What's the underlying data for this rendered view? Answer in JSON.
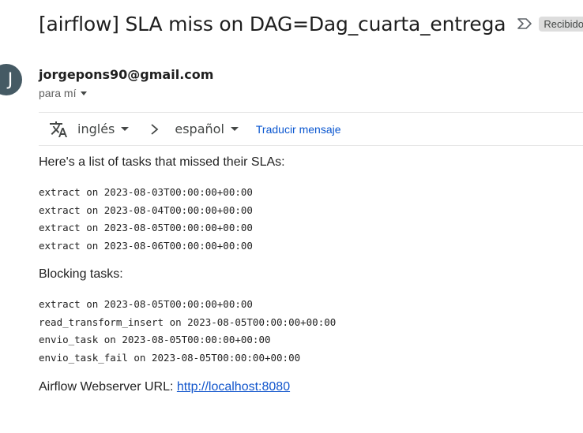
{
  "email": {
    "subject": "[airflow] SLA miss on DAG=Dag_cuarta_entrega",
    "label_chip": "Recibidos",
    "sender": "jorgepons90@gmail.com",
    "recipient": "para mí",
    "avatar_letter": "J"
  },
  "translate_bar": {
    "source_lang": "inglés",
    "target_lang": "español",
    "translate_link": "Traducir mensaje"
  },
  "body": {
    "intro": "Here's a list of tasks that missed their SLAs:",
    "missed_tasks": [
      "extract on 2023-08-03T00:00:00+00:00",
      "extract on 2023-08-04T00:00:00+00:00",
      "extract on 2023-08-05T00:00:00+00:00",
      "extract on 2023-08-06T00:00:00+00:00"
    ],
    "blocking_heading": "Blocking tasks:",
    "blocking_tasks": [
      "extract on 2023-08-05T00:00:00+00:00",
      "read_transform_insert on 2023-08-05T00:00:00+00:00",
      "envio_task on 2023-08-05T00:00:00+00:00",
      "envio_task_fail on 2023-08-05T00:00:00+00:00"
    ],
    "webserver_label": "Airflow Webserver URL:",
    "webserver_url": "http://localhost:8080"
  }
}
